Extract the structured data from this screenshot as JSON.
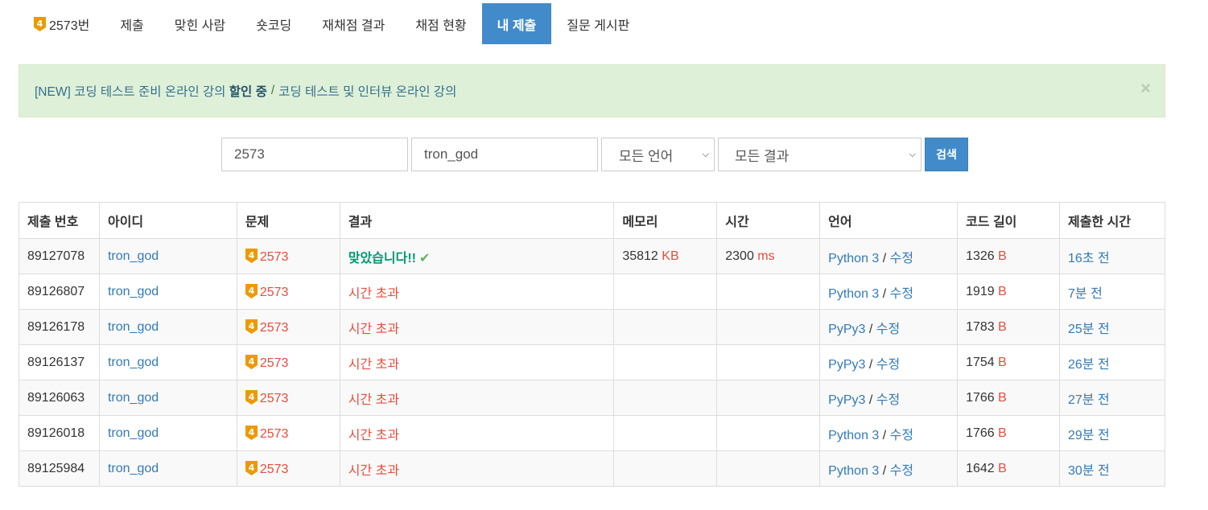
{
  "tabs": [
    {
      "label": "2573번",
      "active": false,
      "tier": "4"
    },
    {
      "label": "제출",
      "active": false
    },
    {
      "label": "맞힌 사람",
      "active": false
    },
    {
      "label": "숏코딩",
      "active": false
    },
    {
      "label": "재채점 결과",
      "active": false
    },
    {
      "label": "채점 현황",
      "active": false
    },
    {
      "label": "내 제출",
      "active": true
    },
    {
      "label": "질문 게시판",
      "active": false
    }
  ],
  "alert": {
    "prefix": "[NEW] 코딩 테스트 준비 온라인 강의",
    "bold": "할인 중",
    "separator": "/",
    "link": "코딩 테스트 및 인터뷰 온라인 강의",
    "close": "×"
  },
  "search": {
    "problem_id": "2573",
    "user_id": "tron_god",
    "language": "모든 언어",
    "result": "모든 결과",
    "button": "검색"
  },
  "table": {
    "headers": [
      "제출 번호",
      "아이디",
      "문제",
      "결과",
      "메모리",
      "시간",
      "언어",
      "코드 길이",
      "제출한 시간"
    ],
    "rows": [
      {
        "id": "89127078",
        "user": "tron_god",
        "tier": "4",
        "problem": "2573",
        "result": "맞았습니다!!",
        "accepted": true,
        "memory": "35812",
        "memory_unit": "KB",
        "time": "2300",
        "time_unit": "ms",
        "language": "Python 3",
        "edit": "수정",
        "length": "1326",
        "length_unit": "B",
        "submitted": "16초 전"
      },
      {
        "id": "89126807",
        "user": "tron_god",
        "tier": "4",
        "problem": "2573",
        "result": "시간 초과",
        "accepted": false,
        "memory": "",
        "memory_unit": "",
        "time": "",
        "time_unit": "",
        "language": "Python 3",
        "edit": "수정",
        "length": "1919",
        "length_unit": "B",
        "submitted": "7분 전"
      },
      {
        "id": "89126178",
        "user": "tron_god",
        "tier": "4",
        "problem": "2573",
        "result": "시간 초과",
        "accepted": false,
        "memory": "",
        "memory_unit": "",
        "time": "",
        "time_unit": "",
        "language": "PyPy3",
        "edit": "수정",
        "length": "1783",
        "length_unit": "B",
        "submitted": "25분 전"
      },
      {
        "id": "89126137",
        "user": "tron_god",
        "tier": "4",
        "problem": "2573",
        "result": "시간 초과",
        "accepted": false,
        "memory": "",
        "memory_unit": "",
        "time": "",
        "time_unit": "",
        "language": "PyPy3",
        "edit": "수정",
        "length": "1754",
        "length_unit": "B",
        "submitted": "26분 전"
      },
      {
        "id": "89126063",
        "user": "tron_god",
        "tier": "4",
        "problem": "2573",
        "result": "시간 초과",
        "accepted": false,
        "memory": "",
        "memory_unit": "",
        "time": "",
        "time_unit": "",
        "language": "PyPy3",
        "edit": "수정",
        "length": "1766",
        "length_unit": "B",
        "submitted": "27분 전"
      },
      {
        "id": "89126018",
        "user": "tron_god",
        "tier": "4",
        "problem": "2573",
        "result": "시간 초과",
        "accepted": false,
        "memory": "",
        "memory_unit": "",
        "time": "",
        "time_unit": "",
        "language": "Python 3",
        "edit": "수정",
        "length": "1766",
        "length_unit": "B",
        "submitted": "29분 전"
      },
      {
        "id": "89125984",
        "user": "tron_god",
        "tier": "4",
        "problem": "2573",
        "result": "시간 초과",
        "accepted": false,
        "memory": "",
        "memory_unit": "",
        "time": "",
        "time_unit": "",
        "language": "Python 3",
        "edit": "수정",
        "length": "1642",
        "length_unit": "B",
        "submitted": "30분 전"
      }
    ]
  },
  "colors": {
    "primary": "#428bca",
    "alert_bg": "#dff0d8",
    "link": "#337ab7",
    "error": "#e74c3c",
    "accepted": "#009874",
    "tier_gold": "#ec9a00"
  },
  "icons": {
    "tier": "gold-tier-shield-icon",
    "check": "checkmark-icon",
    "close": "close-icon",
    "caret": "chevron-down-icon"
  }
}
